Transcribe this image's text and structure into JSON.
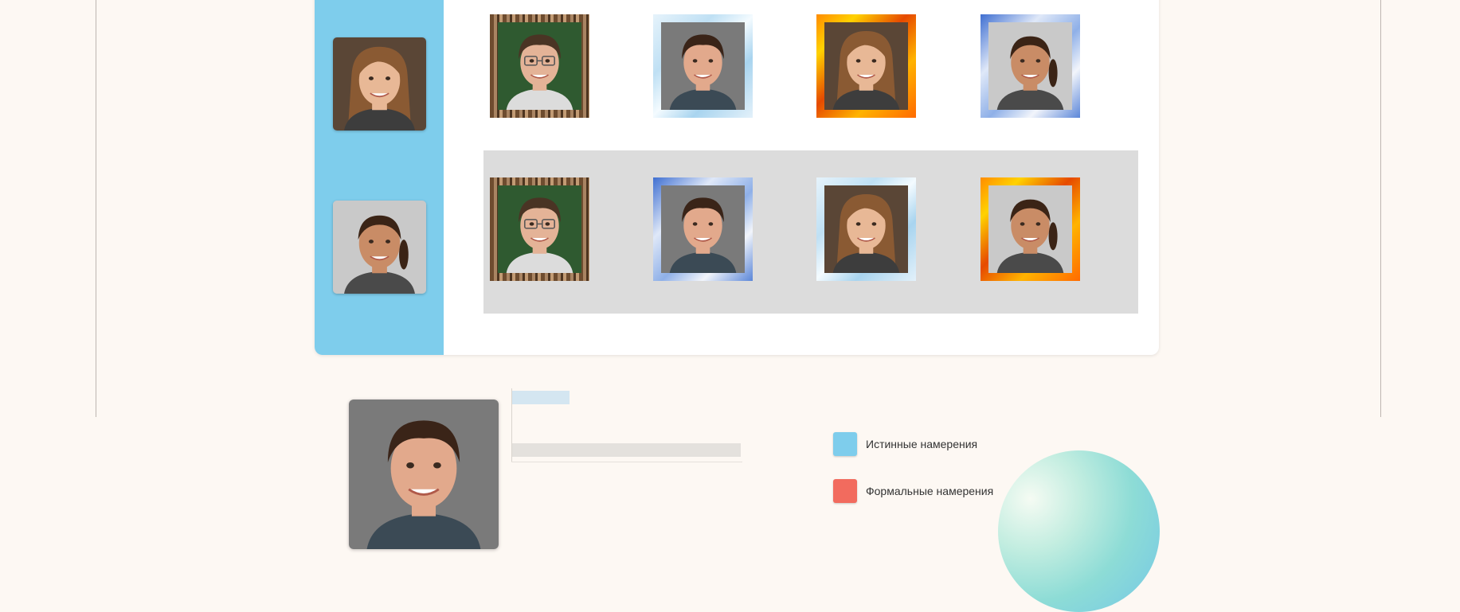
{
  "reference_faces": [
    {
      "name": "face-woman-brown-hair"
    },
    {
      "name": "face-woman-dark-ponytail"
    }
  ],
  "grid": {
    "rows": [
      {
        "cells": [
          {
            "face": "man-glasses",
            "frame": "wood"
          },
          {
            "face": "young-man",
            "frame": "water"
          },
          {
            "face": "woman-brown-hair",
            "frame": "fire"
          },
          {
            "face": "woman-dark-ponytail",
            "frame": "sky"
          }
        ]
      },
      {
        "cells": [
          {
            "face": "man-glasses",
            "frame": "wood"
          },
          {
            "face": "young-man",
            "frame": "sky"
          },
          {
            "face": "woman-brown-hair",
            "frame": "water"
          },
          {
            "face": "woman-dark-ponytail",
            "frame": "fire"
          }
        ]
      }
    ]
  },
  "result": {
    "face": "young-man",
    "bars": [
      {
        "series": "true",
        "color": "#d4e6f1",
        "value": 0.25
      },
      {
        "series": "formal",
        "color": "#e4e1dd",
        "value": 1.0
      }
    ]
  },
  "legend": {
    "items": [
      {
        "label": "Истинные намерения",
        "color": "#7ecdec"
      },
      {
        "label": "Формальные намерения",
        "color": "#f26b5e"
      }
    ]
  },
  "colors": {
    "panel_accent": "#7ecdec",
    "background": "#fdf8f3",
    "row_highlight": "#dcdcdc"
  }
}
